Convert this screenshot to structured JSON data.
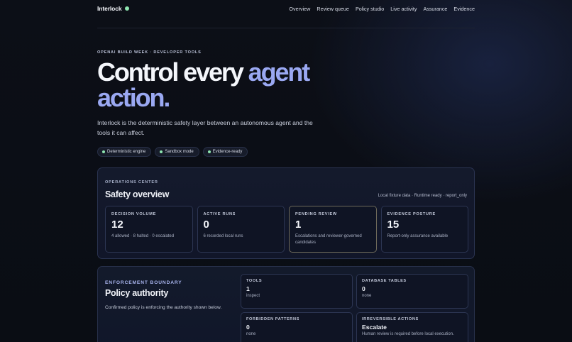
{
  "brand": {
    "name": "Interlock"
  },
  "nav": {
    "items": [
      "Overview",
      "Review queue",
      "Policy studio",
      "Live activity",
      "Assurance",
      "Evidence"
    ]
  },
  "hero": {
    "eyebrow": "OPENAI BUILD WEEK · DEVELOPER TOOLS",
    "title_plain": "Control every ",
    "title_accent_1": "agent",
    "title_accent_2": "action.",
    "lead": "Interlock is the deterministic safety layer between an autonomous agent and the tools it can affect.",
    "pills": [
      "Deterministic engine",
      "Sandbox mode",
      "Evidence-ready"
    ]
  },
  "operations": {
    "eyebrow": "OPERATIONS CENTER",
    "title": "Safety overview",
    "status": "Local fixture data · Runtime ready · report_only",
    "stats": [
      {
        "label": "DECISION VOLUME",
        "value": "12",
        "sub": "4 allowed · 8 halted · 0 escalated"
      },
      {
        "label": "ACTIVE RUNS",
        "value": "0",
        "sub": "6 recorded local runs"
      },
      {
        "label": "PENDING REVIEW",
        "value": "1",
        "sub": "Escalations and reviewer-governed candidates"
      },
      {
        "label": "EVIDENCE POSTURE",
        "value": "15",
        "sub": "Report-only assurance available"
      }
    ]
  },
  "policy": {
    "eyebrow": "ENFORCEMENT BOUNDARY",
    "title": "Policy authority",
    "description": "Confirmed policy is enforcing the authority shown below.",
    "cells": [
      {
        "label": "TOOLS",
        "value": "1",
        "sub": "inspect"
      },
      {
        "label": "DATABASE TABLES",
        "value": "0",
        "sub": "none"
      },
      {
        "label": "FORBIDDEN PATTERNS",
        "value": "0",
        "sub": "none"
      },
      {
        "label": "IRREVERSIBLE ACTIONS",
        "value": "Escalate",
        "sub": "Human review is required before local execution."
      }
    ]
  },
  "colors": {
    "accent": "#9aa8f2",
    "status_green": "#8ee6b0",
    "background": "#0b0e15"
  }
}
